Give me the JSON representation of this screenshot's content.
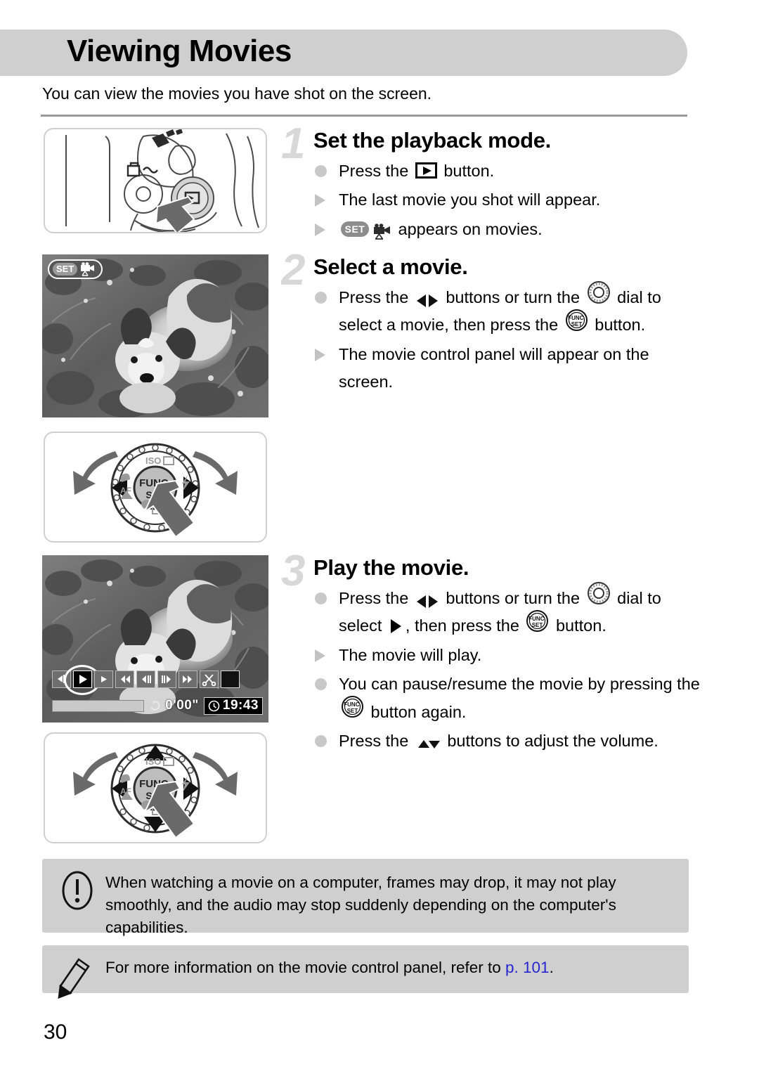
{
  "page": {
    "title": "Viewing Movies",
    "intro": "You can view the movies you have shot on the screen.",
    "page_number": "30"
  },
  "steps": [
    {
      "number": "1",
      "heading": "Set the playback mode.",
      "bullets": [
        {
          "marker": "dot",
          "before": "Press the ",
          "icon": "playback-button-icon",
          "after": " button."
        },
        {
          "marker": "triangle",
          "before": "The last movie you shot will appear.",
          "icon": null,
          "after": ""
        },
        {
          "marker": "triangle",
          "before": "",
          "icon": "set-movie-icon",
          "after": " appears on movies."
        }
      ]
    },
    {
      "number": "2",
      "heading": "Select a movie.",
      "bullets": [
        {
          "marker": "dot",
          "segments": [
            "Press the ",
            "lr-arrows-icon",
            " buttons or turn the ",
            "dial-icon",
            " dial to select a movie, then press the ",
            "func-set-icon",
            " button."
          ]
        },
        {
          "marker": "triangle",
          "segments": [
            "The movie control panel will appear on the screen."
          ]
        }
      ]
    },
    {
      "number": "3",
      "heading": "Play the movie.",
      "bullets": [
        {
          "marker": "dot",
          "segments": [
            "Press the ",
            "lr-arrows-icon",
            " buttons or turn the ",
            "dial-icon",
            " dial to select ",
            "right-arrow-icon",
            " , then press the ",
            "func-set-icon",
            " button."
          ]
        },
        {
          "marker": "triangle",
          "segments": [
            "The movie will play."
          ]
        },
        {
          "marker": "dot",
          "segments": [
            "You can pause/resume the movie by pressing the ",
            "func-set-icon",
            " button again."
          ]
        },
        {
          "marker": "dot",
          "segments": [
            "Press the ",
            "ud-arrows-icon",
            " buttons to adjust the volume."
          ]
        }
      ]
    }
  ],
  "step_text": {
    "s1_b1_a": "Press the ",
    "s1_b1_b": " button.",
    "s1_b2": "The last movie you shot will appear.",
    "s1_b3_b": " appears on movies.",
    "s2_b1_a": "Press the ",
    "s2_b1_b": " buttons or turn the ",
    "s2_b1_c": " dial",
    "s2_b1_d": "to select a movie, then press the ",
    "s2_b1_e": "button.",
    "s2_b2": "The movie control panel will appear on the screen.",
    "s3_b1_a": "Press the ",
    "s3_b1_b": " buttons or turn the ",
    "s3_b1_c": " dial",
    "s3_b1_d": "to select ",
    "s3_b1_e": ", then press the ",
    "s3_b1_f": " button.",
    "s3_b2": "The movie will play.",
    "s3_b3_a": "You can pause/resume the movie by",
    "s3_b3_b": "pressing the ",
    "s3_b3_c": " button again.",
    "s3_b4_a": "Press the ",
    "s3_b4_b": " buttons to adjust the",
    "s3_b4_c": "volume."
  },
  "badges": {
    "set_label": "SET"
  },
  "screen": {
    "elapsed_time": "0'00\"",
    "total_time": "19:43",
    "control_buttons": [
      "exit-icon",
      "play-icon",
      "slow-motion-icon",
      "skip-back-icon",
      "frame-back-icon",
      "frame-forward-icon",
      "skip-forward-icon",
      "edit-scissors-icon",
      "stop-icon"
    ],
    "selected_button": "play-icon"
  },
  "notes": [
    {
      "icon": "warning-icon",
      "text": "When watching a movie on a computer, frames may drop, it may not play smoothly, and the audio may stop suddenly depending on the computer's capabilities."
    },
    {
      "icon": "pencil-note-icon",
      "text_before": "For more information on the movie control panel, refer to ",
      "link": "p. 101",
      "text_after": "."
    }
  ],
  "colors": {
    "header_bg": "#cfcfcf",
    "note_bg": "#cfcfcf",
    "link": "#2626cf",
    "step_number": "#d8d8d8"
  }
}
